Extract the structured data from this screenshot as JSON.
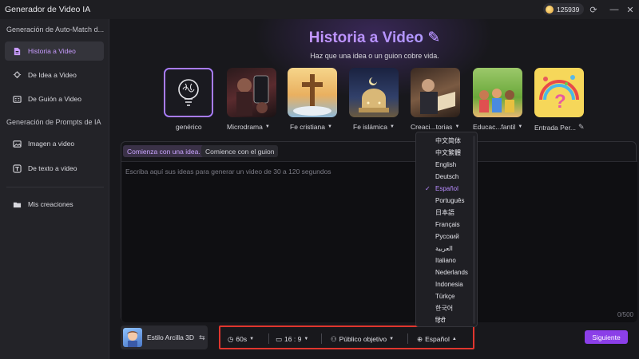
{
  "window": {
    "title": "Generador de Video IA",
    "coins": "125939"
  },
  "sidebar": {
    "section1_title": "Generación de Auto-Match d...",
    "section2_title": "Generación de Prompts de IA",
    "items": [
      {
        "label": "Historia a Video",
        "icon": "file-icon"
      },
      {
        "label": "De Idea a Video",
        "icon": "lightbulb-icon"
      },
      {
        "label": "De Guión a Video",
        "icon": "script-icon"
      },
      {
        "label": "Imagen a video",
        "icon": "image-icon"
      },
      {
        "label": "De texto a video",
        "icon": "text-icon"
      },
      {
        "label": "Mis creaciones",
        "icon": "folder-icon"
      }
    ]
  },
  "hero": {
    "title": "Historia a Video",
    "subtitle": "Haz que una idea o un guion cobre vida."
  },
  "categories": [
    {
      "label": "genérico"
    },
    {
      "label": "Microdrama"
    },
    {
      "label": "Fe cristiana"
    },
    {
      "label": "Fe islámica"
    },
    {
      "label": "Creaci...torias"
    },
    {
      "label": "Educac...fantil"
    },
    {
      "label": "Entrada Per..."
    }
  ],
  "prompt": {
    "tab_idea": "Comienza con una idea.",
    "tab_script": "Comience con el guion",
    "placeholder": "Escriba aquí sus ideas para generar un video de 30 a 120 segundos",
    "counter": "0/500"
  },
  "bottom": {
    "style": "Estilo Arcilla 3D",
    "duration": "60s",
    "ratio": "16 : 9",
    "audience": "Público objetivo",
    "language": "Español",
    "next": "Siguiente"
  },
  "language_options": [
    "中文简体",
    "中文繁體",
    "English",
    "Deutsch",
    "Español",
    "Português",
    "日本語",
    "Français",
    "Русский",
    "العربية",
    "Italiano",
    "Nederlands",
    "Indonesia",
    "Türkçe",
    "한국어",
    "हिंदी"
  ],
  "selected_language_index": 4,
  "colors": {
    "accent": "#8b3fe8",
    "highlight_border": "#e0362e",
    "active_text": "#c89cff"
  }
}
